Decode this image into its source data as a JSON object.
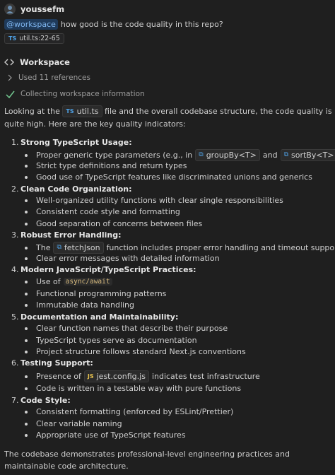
{
  "user": {
    "name": "youssefm"
  },
  "prompt": {
    "mention": "@workspace",
    "text": "how good is the code quality in this repo?"
  },
  "reference_chip": {
    "lang": "TS",
    "label": "util.ts:22-65"
  },
  "workspace": {
    "title": "Workspace",
    "used_references": "Used 11 references",
    "status": "Collecting workspace information"
  },
  "intro": {
    "before": "Looking at the",
    "file_lang": "TS",
    "file": "util.ts",
    "after": "file and the overall codebase structure, the code quality is quite high. Here are the key quality indicators:"
  },
  "sections": [
    {
      "num": "1.",
      "title": "Strong TypeScript Usage",
      "colon": ":",
      "bullets": [
        {
          "parts": [
            "Proper generic type parameters (e.g., in",
            "groupBy<T>",
            "and",
            "sortBy<T>",
            ")"
          ]
        },
        {
          "text": "Strict type definitions and return types"
        },
        {
          "text": "Good use of TypeScript features like discriminated unions and generics"
        }
      ]
    },
    {
      "num": "2.",
      "title": "Clean Code Organization",
      "colon": ":",
      "bullets": [
        {
          "text": "Well-organized utility functions with clear single responsibilities"
        },
        {
          "text": "Consistent code style and formatting"
        },
        {
          "text": "Good separation of concerns between files"
        }
      ]
    },
    {
      "num": "3.",
      "title": "Robust Error Handling",
      "colon": ":",
      "bullets": [
        {
          "parts": [
            "The",
            "fetchJson",
            "function includes proper error handling and timeout support"
          ]
        },
        {
          "text": "Clear error messages with detailed information"
        }
      ]
    },
    {
      "num": "4.",
      "title": "Modern JavaScript/TypeScript Practices",
      "colon": ":",
      "bullets": [
        {
          "parts": [
            "Use of",
            "async/await"
          ]
        },
        {
          "text": "Functional programming patterns"
        },
        {
          "text": "Immutable data handling"
        }
      ]
    },
    {
      "num": "5.",
      "title": "Documentation and Maintainability",
      "colon": ":",
      "bullets": [
        {
          "text": "Clear function names that describe their purpose"
        },
        {
          "text": "TypeScript types serve as documentation"
        },
        {
          "text": "Project structure follows standard Next.js conventions"
        }
      ]
    },
    {
      "num": "6.",
      "title": "Testing Support",
      "colon": ":",
      "bullets": [
        {
          "parts": [
            "Presence of",
            "JS",
            "jest.config.js",
            "indicates test infrastructure"
          ]
        },
        {
          "text": "Code is written in a testable way with pure functions"
        }
      ]
    },
    {
      "num": "7.",
      "title": "Code Style",
      "colon": ":",
      "bullets": [
        {
          "text": "Consistent formatting (enforced by ESLint/Prettier)"
        },
        {
          "text": "Clear variable naming"
        },
        {
          "text": "Appropriate use of TypeScript features"
        }
      ]
    }
  ],
  "outro": "The codebase demonstrates professional-level engineering practices and maintainable code architecture.",
  "colors": {
    "background": "#1f1f1f",
    "text": "#cccccc",
    "accent": "#4fa3e8",
    "success": "#73c991",
    "mention_bg": "#1f3a5a"
  }
}
